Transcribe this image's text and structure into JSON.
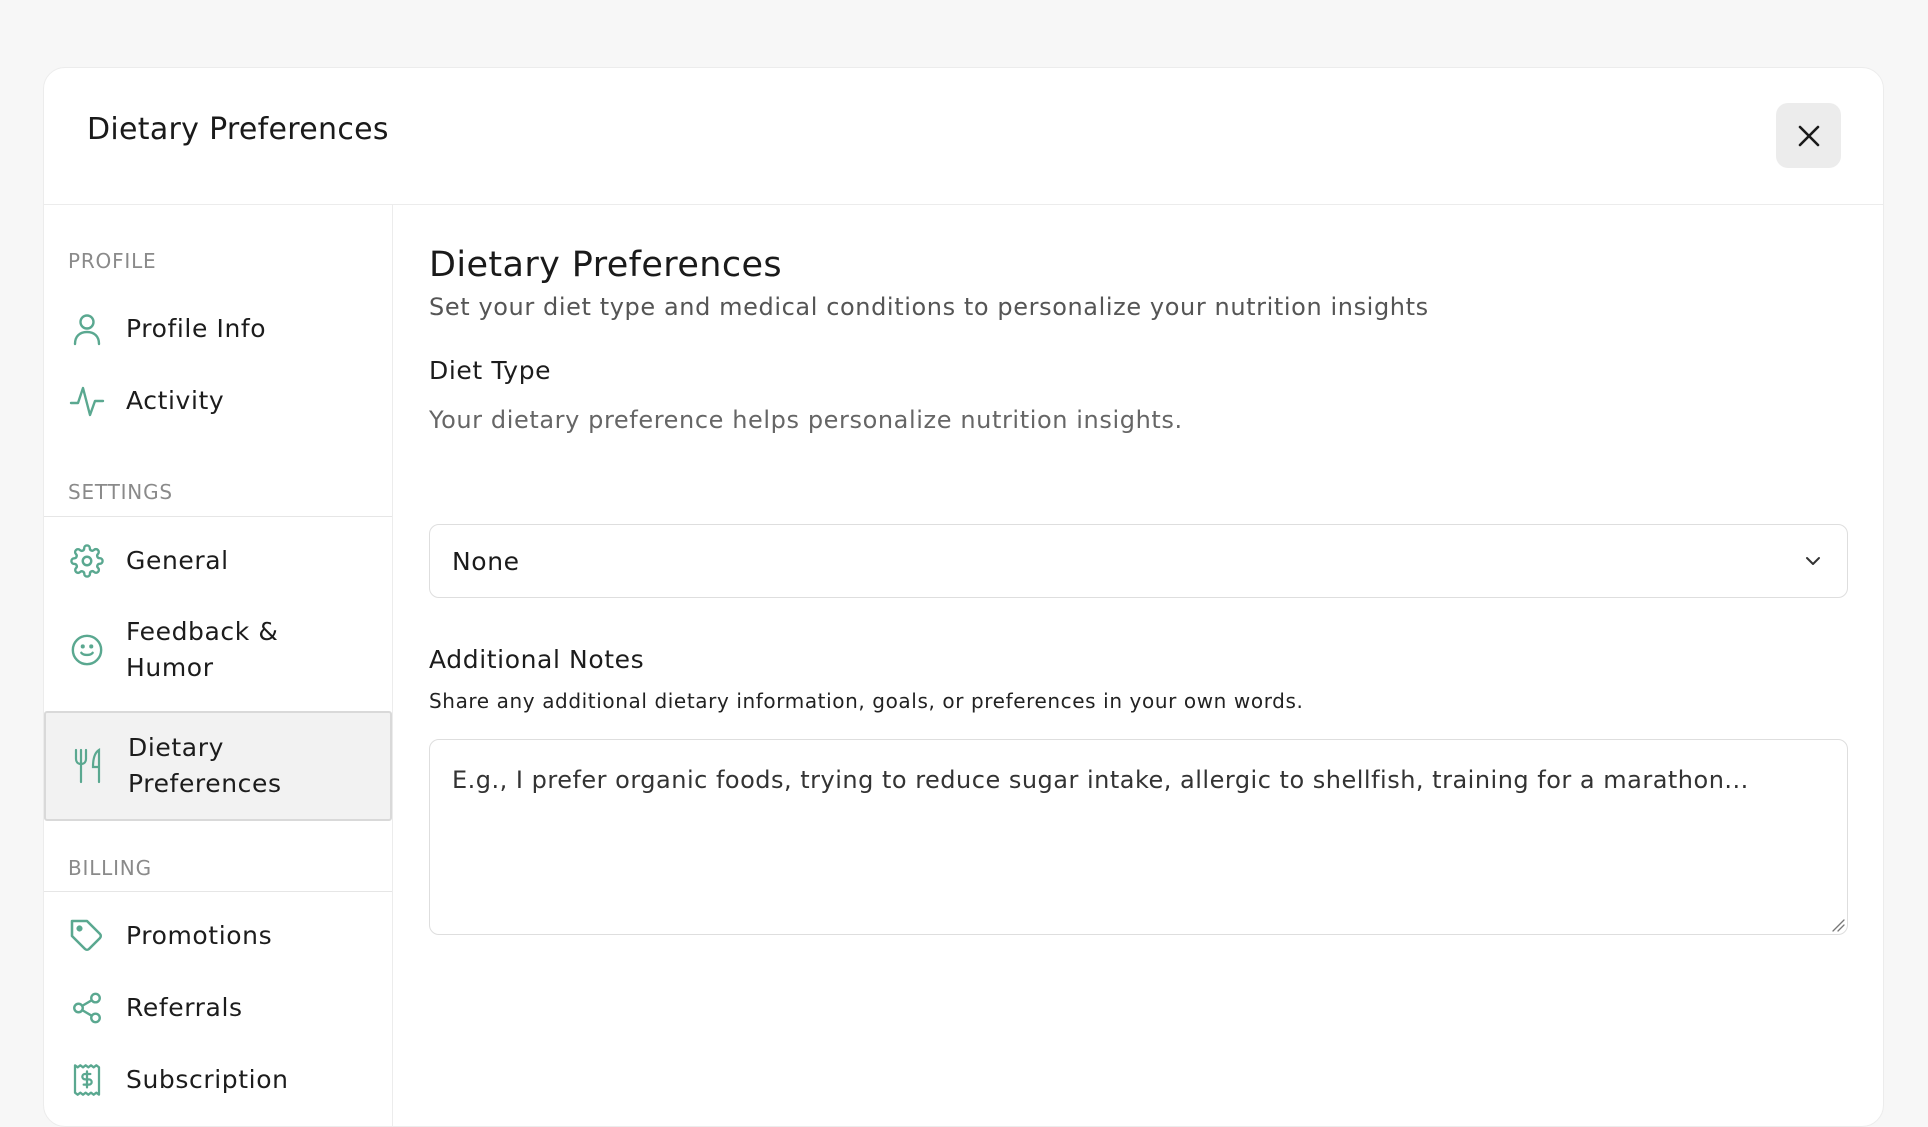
{
  "modal": {
    "title": "Dietary Preferences",
    "close_icon": "close-icon"
  },
  "sidebar": {
    "groups": [
      {
        "label": "PROFILE",
        "items": [
          {
            "label": "Profile Info",
            "icon": "user-icon"
          },
          {
            "label": "Activity",
            "icon": "activity-icon"
          }
        ]
      },
      {
        "label": "SETTINGS",
        "items": [
          {
            "label": "General",
            "icon": "gear-icon"
          },
          {
            "label": "Feedback &\nHumor",
            "icon": "smile-icon"
          },
          {
            "label": "Dietary\nPreferences",
            "icon": "utensils-icon",
            "active": true
          }
        ]
      },
      {
        "label": "BILLING",
        "items": [
          {
            "label": "Promotions",
            "icon": "tag-icon"
          },
          {
            "label": "Referrals",
            "icon": "share-icon"
          },
          {
            "label": "Subscription",
            "icon": "receipt-dollar-icon"
          }
        ]
      }
    ]
  },
  "content": {
    "title": "Dietary Preferences",
    "subtitle": "Set your diet type and medical conditions to personalize your nutrition insights",
    "diet_type": {
      "label": "Diet Type",
      "help": "Your dietary preference helps personalize nutrition insights.",
      "selected": "None"
    },
    "notes": {
      "label": "Additional Notes",
      "help": "Share any additional dietary information, goals, or preferences in your own words.",
      "placeholder": "E.g., I prefer organic foods, trying to reduce sugar intake, allergic to shellfish, training for a marathon..."
    }
  },
  "colors": {
    "accent": "#5aa890",
    "active_bg": "#f2f2f2"
  }
}
